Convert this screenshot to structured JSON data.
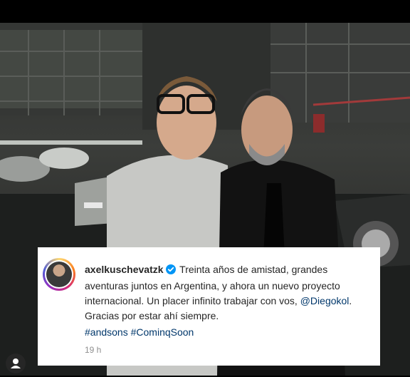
{
  "post": {
    "username": "axelkuschevatzk",
    "caption_part1": " Treinta años de amistad, grandes aventuras juntos en Argentina, y ahora un nuevo proyecto internacional. Un placer infinito trabajar con vos, ",
    "mention": "@Diegokol",
    "caption_part2": ". Gracias por estar ahí siempre.",
    "hashtag1": "#andsons",
    "hashtag2": "#CominqSoon",
    "timestamp": "19 h",
    "verified_color": "#0095f6",
    "link_color": "#00376b"
  },
  "icons": {
    "verified": "verified-badge-icon",
    "user_tag": "user-tag-icon"
  }
}
